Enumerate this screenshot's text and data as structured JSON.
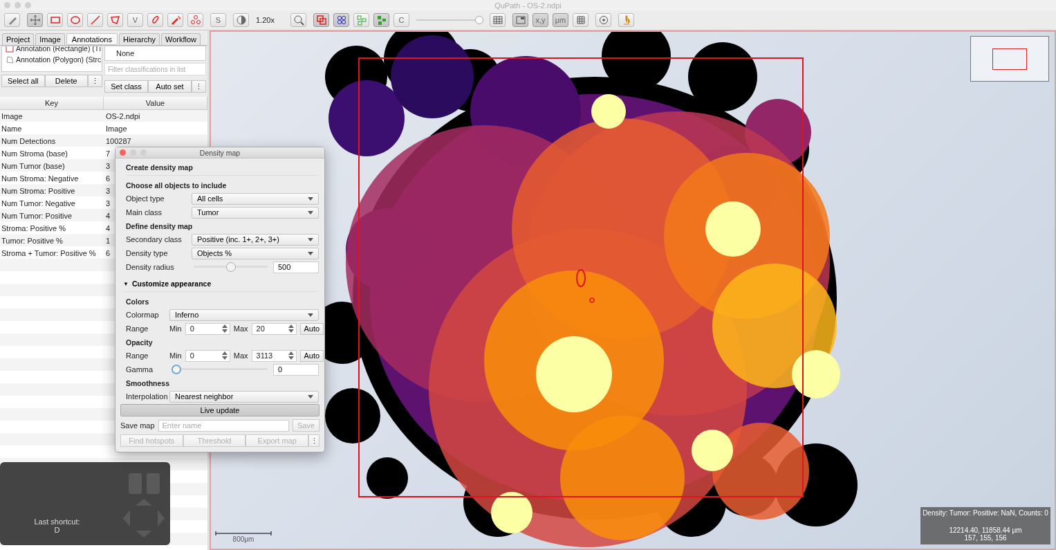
{
  "window": {
    "title": "QuPath - OS-2.ndpi"
  },
  "toolbar": {
    "groups": [
      [
        {
          "kind": "pencil",
          "selected": false
        }
      ],
      [
        {
          "kind": "move",
          "selected": true
        },
        {
          "kind": "rectangle",
          "selected": false
        },
        {
          "kind": "ellipse",
          "selected": false
        },
        {
          "kind": "line",
          "selected": false
        },
        {
          "kind": "polygon",
          "selected": false
        },
        {
          "kind": "text",
          "text": "V",
          "selected": false
        },
        {
          "kind": "brush",
          "selected": false
        },
        {
          "kind": "wand",
          "selected": false
        },
        {
          "kind": "points",
          "selected": false
        }
      ],
      [
        {
          "kind": "text",
          "text": "S",
          "selected": false
        }
      ],
      [
        {
          "kind": "contrast",
          "selected": false
        }
      ]
    ],
    "zoom_label": "1.20x",
    "groups2": [
      [
        {
          "kind": "zoom",
          "selected": false
        }
      ],
      [
        {
          "kind": "annotations",
          "selected": true
        },
        {
          "kind": "tma",
          "selected": true
        },
        {
          "kind": "detections",
          "selected": false
        },
        {
          "kind": "fill",
          "selected": true
        },
        {
          "kind": "text",
          "text": "C",
          "selected": false
        }
      ]
    ],
    "opacity_slider": {
      "level": 0.95
    },
    "groups3": [
      [
        {
          "kind": "table",
          "selected": false
        }
      ],
      [
        {
          "kind": "overview",
          "selected": true
        },
        {
          "kind": "text",
          "text": "x,y",
          "selected": true
        },
        {
          "kind": "text",
          "text": "μm",
          "selected": true
        },
        {
          "kind": "grid",
          "selected": false
        }
      ],
      [
        {
          "kind": "target",
          "selected": false
        }
      ],
      [
        {
          "kind": "microscope",
          "selected": false
        }
      ]
    ]
  },
  "tabs": [
    {
      "label": "Project",
      "selected": false
    },
    {
      "label": "Image",
      "selected": false
    },
    {
      "label": "Annotations",
      "selected": true
    },
    {
      "label": "Hierarchy",
      "selected": false
    },
    {
      "label": "Workflow",
      "selected": false
    }
  ],
  "annotations": {
    "items": [
      {
        "label": "Annotation (Rectangle) (Tı",
        "kind": "rectangle"
      },
      {
        "label": "Annotation (Polygon) (Strc",
        "kind": "polygon"
      }
    ],
    "buttons": [
      "Select all",
      "Delete",
      "⋮"
    ]
  },
  "classes": {
    "items": [
      "None"
    ],
    "filter_placeholder": "Filter classifications in list",
    "buttons": [
      "Set class",
      "Auto set",
      "⋮"
    ]
  },
  "table": {
    "columns": [
      "Key",
      "Value"
    ],
    "rows": [
      [
        "Image",
        "OS-2.ndpi"
      ],
      [
        "Name",
        "Image"
      ],
      [
        "Num Detections",
        "100287"
      ],
      [
        "Num Stroma (base)",
        "7"
      ],
      [
        "Num Tumor (base)",
        "3"
      ],
      [
        "Num Stroma: Negative",
        "6"
      ],
      [
        "Num Stroma: Positive",
        "3"
      ],
      [
        "Num Tumor: Negative",
        "3"
      ],
      [
        "Num Tumor: Positive",
        "4"
      ],
      [
        "Stroma: Positive %",
        "4"
      ],
      [
        "Tumor: Positive %",
        "1"
      ],
      [
        "Stroma + Tumor: Positive %",
        "6"
      ]
    ]
  },
  "shortcut": {
    "label": "Last shortcut:",
    "key": "D"
  },
  "dialog": {
    "title": "Density map",
    "rows": [
      {
        "kind": "title",
        "text": "Create density map"
      },
      {
        "kind": "heading",
        "text": "Choose all objects to include"
      },
      {
        "kind": "select",
        "label": "Object type",
        "value": "All cells"
      },
      {
        "kind": "select",
        "label": "Main class",
        "value": "Tumor"
      },
      {
        "kind": "heading",
        "text": "Define density map"
      },
      {
        "kind": "select",
        "label": "Secondary class",
        "value": "Positive (inc. 1+, 2+, 3+)"
      },
      {
        "kind": "select",
        "label": "Density type",
        "value": "Objects %"
      },
      {
        "kind": "slider",
        "label": "Density radius",
        "level": 0.5,
        "value": "500"
      },
      {
        "kind": "expander",
        "text": "Customize appearance",
        "expanded": true,
        "arrow": "▼"
      },
      {
        "kind": "heading",
        "text": "Colors"
      },
      {
        "kind": "select",
        "label": "Colormap",
        "value": "Inferno"
      },
      {
        "kind": "range",
        "label": "Range",
        "min_label": "Min",
        "min": "0",
        "max_label": "Max",
        "max": "20",
        "button": "Auto"
      },
      {
        "kind": "heading",
        "text": "Opacity"
      },
      {
        "kind": "range",
        "label": "Range",
        "min_label": "Min",
        "min": "0",
        "max_label": "Max",
        "max": "3113",
        "button": "Auto"
      },
      {
        "kind": "slider",
        "label": "Gamma",
        "level": 0,
        "value": "0"
      },
      {
        "kind": "heading",
        "text": "Smoothness"
      },
      {
        "kind": "select",
        "label": "Interpolation",
        "value": "Nearest neighbor"
      }
    ],
    "live_update": "Live update",
    "save": {
      "label": "Save map",
      "placeholder": "Enter name",
      "button": "Save",
      "disabled": true
    },
    "actions": [
      {
        "label": "Find hotspots",
        "disabled": true
      },
      {
        "label": "Threshold",
        "disabled": true
      },
      {
        "label": "Export map",
        "disabled": true
      },
      {
        "label": "⋮",
        "disabled": false
      }
    ]
  },
  "viewer": {
    "scale_label": "800μm",
    "info": [
      "Density: Tumor: Positive: NaN, Counts: 0",
      "12214.40, 11858.44 μm",
      "157, 155, 156"
    ]
  }
}
